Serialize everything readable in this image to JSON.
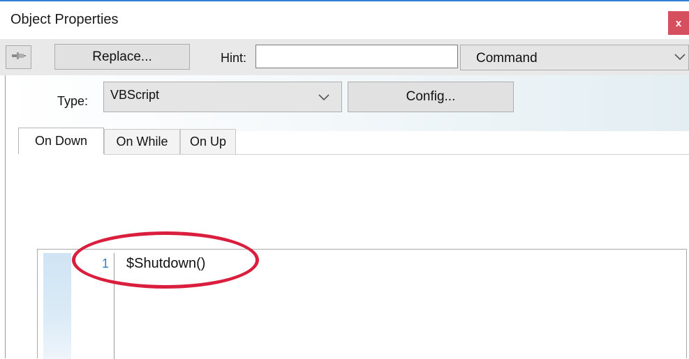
{
  "window": {
    "title": "Object Properties",
    "close_label": "x"
  },
  "toolbar": {
    "pin_icon": "pin-icon",
    "replace_label": "Replace...",
    "hint_label": "Hint:",
    "hint_value": "",
    "command_value": "Command"
  },
  "type_row": {
    "type_label": "Type:",
    "type_value": "VBScript",
    "config_label": "Config..."
  },
  "tabs": [
    {
      "label": "On Down",
      "active": true
    },
    {
      "label": "On While",
      "active": false
    },
    {
      "label": "On Up",
      "active": false
    }
  ],
  "editor": {
    "lines": [
      {
        "number": "1",
        "code": "$Shutdown()"
      }
    ]
  },
  "annotation": {
    "color": "#d91e3e"
  }
}
